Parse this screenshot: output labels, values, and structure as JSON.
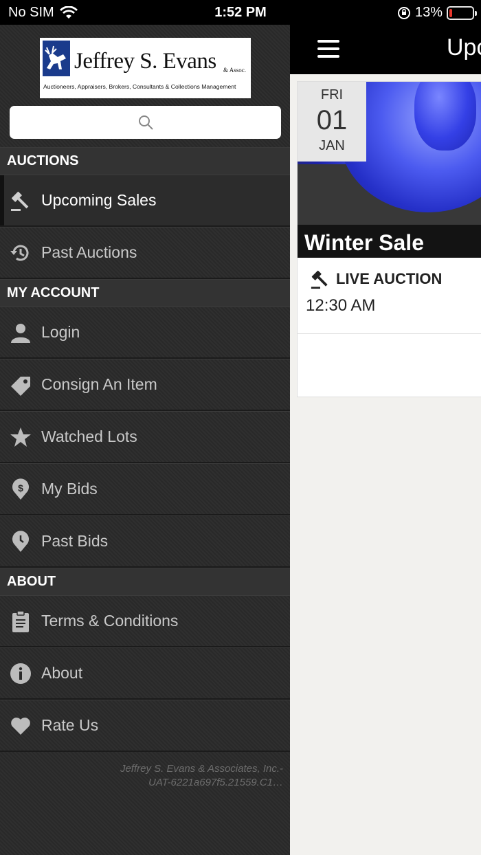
{
  "status_bar": {
    "carrier": "No SIM",
    "time": "1:52 PM",
    "battery": "13%",
    "battery_level": 0.13
  },
  "logo": {
    "name": "Jeffrey S. Evans",
    "assoc": "& Assoc.",
    "tagline": "Auctioneers, Appraisers, Brokers, Consultants & Collections Management"
  },
  "search": {
    "placeholder": ""
  },
  "menu": {
    "sections": [
      {
        "header": "AUCTIONS",
        "items": [
          {
            "label": "Upcoming Sales",
            "icon": "gavel-icon",
            "active": true
          },
          {
            "label": "Past Auctions",
            "icon": "history-icon"
          }
        ]
      },
      {
        "header": "MY ACCOUNT",
        "items": [
          {
            "label": "Login",
            "icon": "user-icon"
          },
          {
            "label": "Consign An Item",
            "icon": "tag-icon"
          },
          {
            "label": "Watched Lots",
            "icon": "star-icon"
          },
          {
            "label": "My Bids",
            "icon": "dollar-pin-icon"
          },
          {
            "label": "Past Bids",
            "icon": "clock-pin-icon"
          }
        ]
      },
      {
        "header": "ABOUT",
        "items": [
          {
            "label": "Terms & Conditions",
            "icon": "clipboard-icon"
          },
          {
            "label": "About",
            "icon": "info-icon"
          },
          {
            "label": "Rate Us",
            "icon": "heart-icon"
          }
        ]
      }
    ],
    "footer_line1": "Jeffrey S. Evans & Associates, Inc.-",
    "footer_line2": "UAT-6221a697f5.21559.C1…"
  },
  "topbar": {
    "title": "Upcoming Sales"
  },
  "sale_card": {
    "date_dow": "FRI",
    "date_day": "01",
    "date_month": "JAN",
    "title": "Winter Sale",
    "type_label": "LIVE AUCTION",
    "time": "12:30 AM"
  },
  "colors": {
    "battery_low": "#ff3b30",
    "menu_bg": "#2a2a2a",
    "logo_blue": "#1a3b8c"
  }
}
